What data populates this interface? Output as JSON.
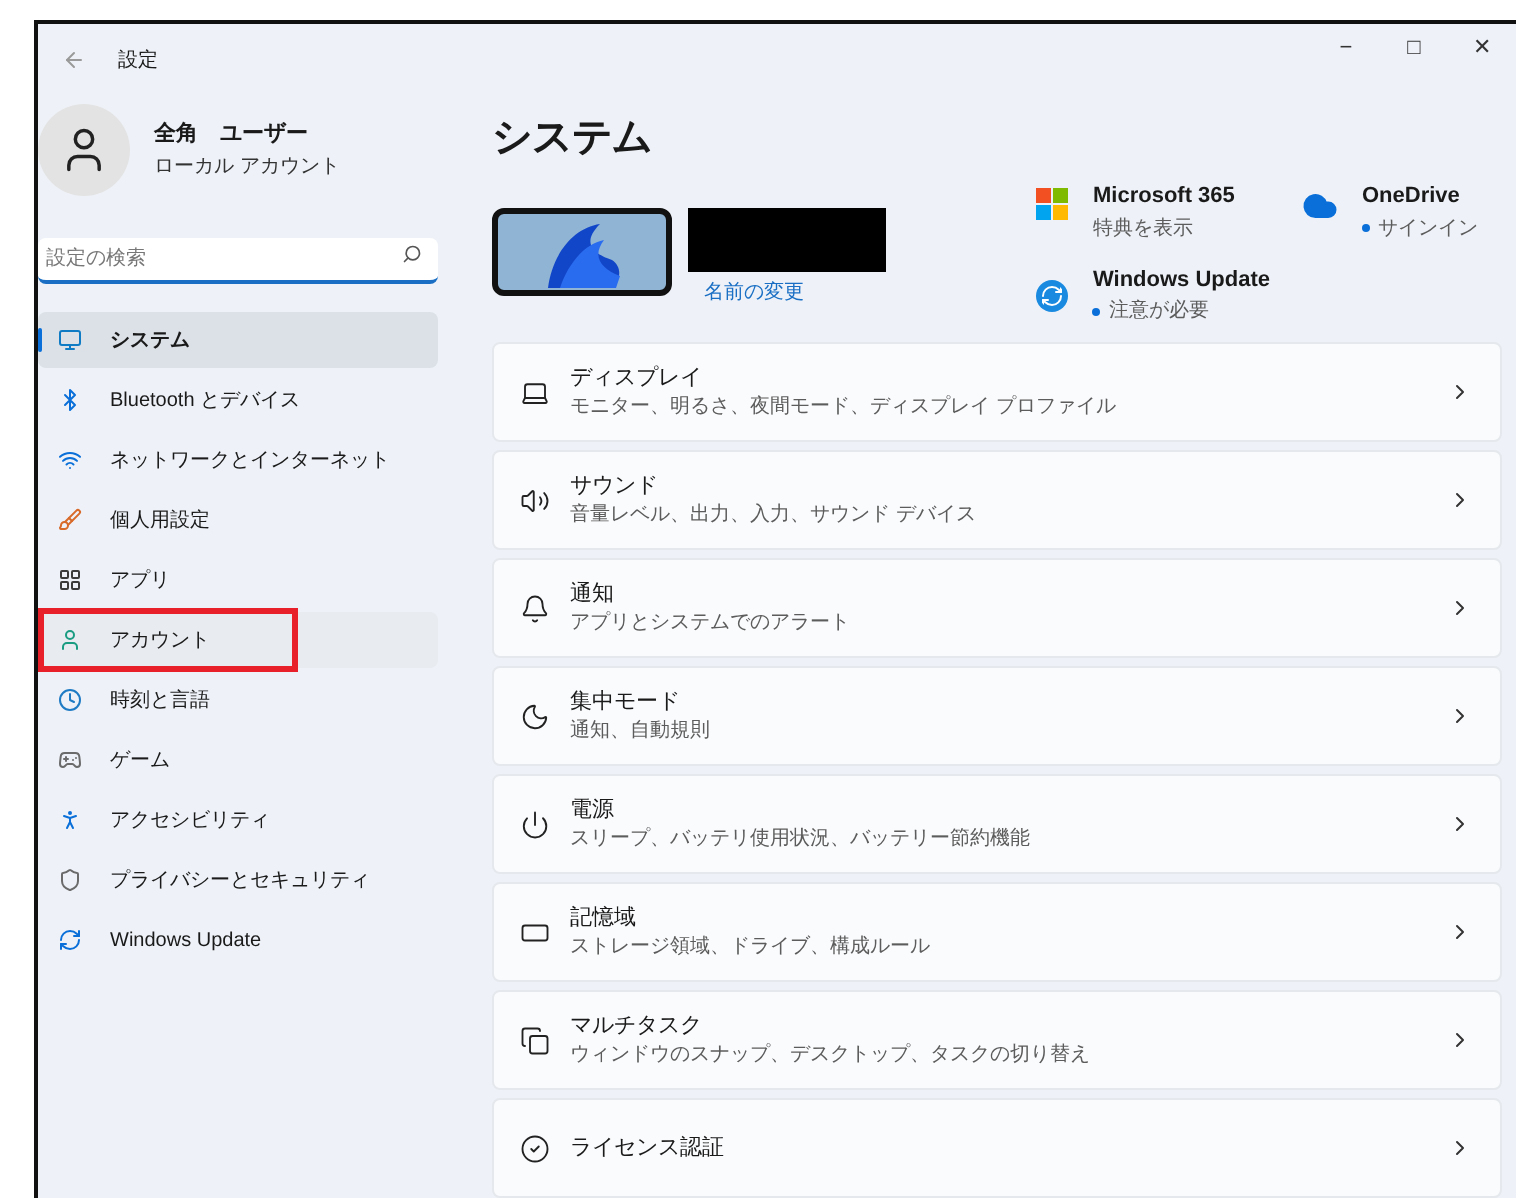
{
  "window": {
    "title": "設定",
    "controls": [
      "−",
      "□",
      "✕"
    ]
  },
  "profile": {
    "name": "全角　ユーザー",
    "account_type": "ローカル アカウント"
  },
  "search": {
    "placeholder": "設定の検索"
  },
  "sidebar": {
    "items": [
      {
        "label": "システム",
        "selected": true,
        "annotated": false
      },
      {
        "label": "Bluetooth とデバイス",
        "selected": false,
        "annotated": false
      },
      {
        "label": "ネットワークとインターネット",
        "selected": false,
        "annotated": false
      },
      {
        "label": "個人用設定",
        "selected": false,
        "annotated": false
      },
      {
        "label": "アプリ",
        "selected": false,
        "annotated": false
      },
      {
        "label": "アカウント",
        "selected": false,
        "annotated": true
      },
      {
        "label": "時刻と言語",
        "selected": false,
        "annotated": false
      },
      {
        "label": "ゲーム",
        "selected": false,
        "annotated": false
      },
      {
        "label": "アクセシビリティ",
        "selected": false,
        "annotated": false
      },
      {
        "label": "プライバシーとセキュリティ",
        "selected": false,
        "annotated": false
      },
      {
        "label": "Windows Update",
        "selected": false,
        "annotated": false
      }
    ]
  },
  "page": {
    "title": "システム",
    "rename_link": "名前の変更",
    "tiles": [
      {
        "title": "Microsoft 365",
        "subtitle": "特典を表示",
        "status_dot": false
      },
      {
        "title": "OneDrive",
        "subtitle": "サインイン",
        "status_dot": true
      },
      {
        "title": "Windows Update",
        "subtitle": "注意が必要",
        "status_dot": true
      }
    ],
    "cards": [
      {
        "title": "ディスプレイ",
        "subtitle": "モニター、明るさ、夜間モード、ディスプレイ プロファイル"
      },
      {
        "title": "サウンド",
        "subtitle": "音量レベル、出力、入力、サウンド デバイス"
      },
      {
        "title": "通知",
        "subtitle": "アプリとシステムでのアラート"
      },
      {
        "title": "集中モード",
        "subtitle": "通知、自動規則"
      },
      {
        "title": "電源",
        "subtitle": "スリープ、バッテリ使用状況、バッテリー節約機能"
      },
      {
        "title": "記憶域",
        "subtitle": "ストレージ領域、ドライブ、構成ルール"
      },
      {
        "title": "マルチタスク",
        "subtitle": "ウィンドウのスナップ、デスクトップ、タスクの切り替え"
      },
      {
        "title": "ライセンス認証"
      }
    ]
  }
}
